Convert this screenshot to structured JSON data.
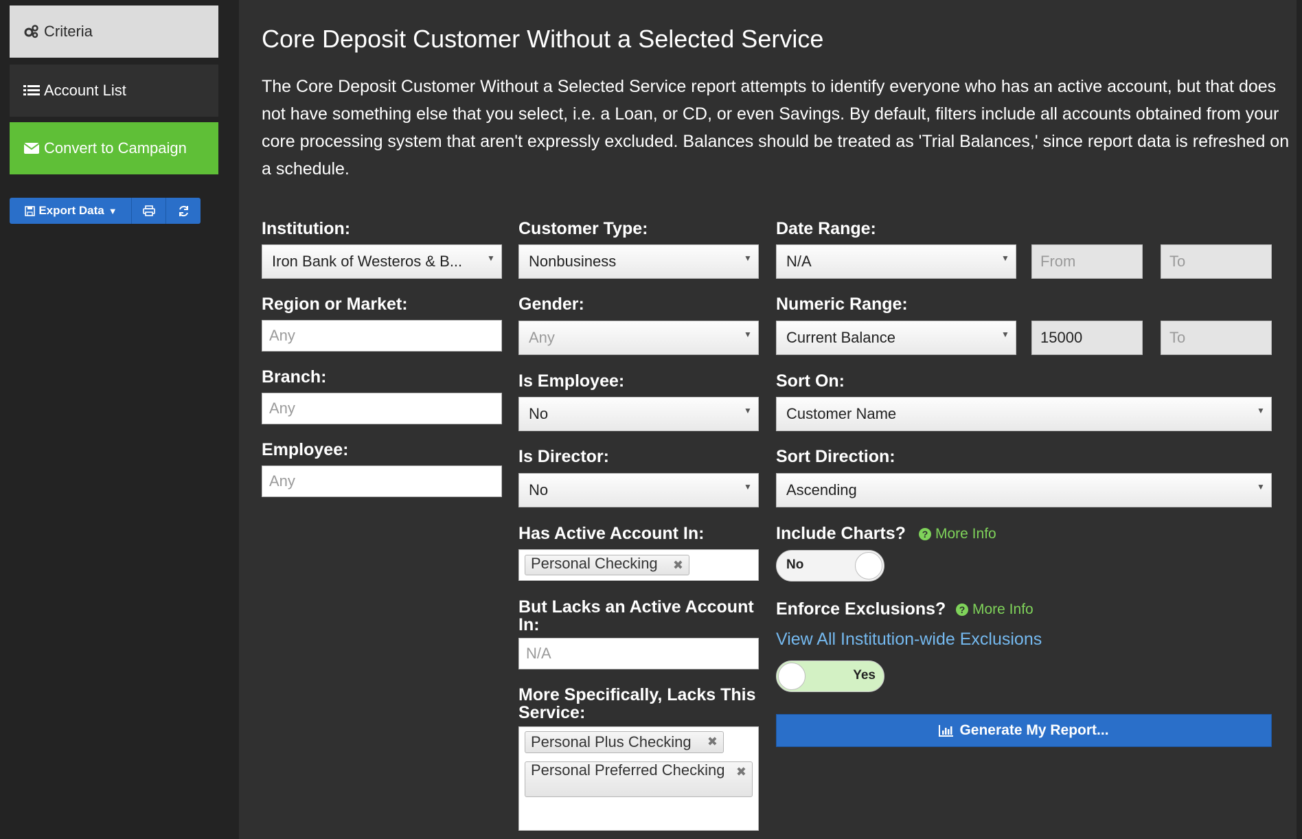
{
  "sidebar": {
    "criteria": "Criteria",
    "account_list": "Account List",
    "convert": "Convert to Campaign",
    "export": "Export Data"
  },
  "page": {
    "title": "Core Deposit Customer Without a Selected Service",
    "description": "The Core Deposit Customer Without a Selected Service report attempts to identify everyone who has an active account, but that does not have something else that you select, i.e. a Loan, or CD, or even Savings. By default, filters include all accounts obtained from your core processing system that aren't expressly excluded. Balances should be treated as 'Trial Balances,' since report data is refreshed on a schedule."
  },
  "filters": {
    "institution": {
      "label": "Institution:",
      "value": "Iron Bank of Westeros & B..."
    },
    "region": {
      "label": "Region or Market:",
      "placeholder": "Any"
    },
    "branch": {
      "label": "Branch:",
      "placeholder": "Any"
    },
    "employee": {
      "label": "Employee:",
      "placeholder": "Any"
    },
    "customer_type": {
      "label": "Customer Type:",
      "value": "Nonbusiness"
    },
    "gender": {
      "label": "Gender:",
      "value": "Any"
    },
    "is_employee": {
      "label": "Is Employee:",
      "value": "No"
    },
    "is_director": {
      "label": "Is Director:",
      "value": "No"
    },
    "has_active": {
      "label": "Has Active Account In:",
      "tags": [
        "Personal Checking"
      ]
    },
    "lacks_active": {
      "label": "But Lacks an Active Account In:",
      "placeholder": "N/A"
    },
    "lacks_service": {
      "label": "More Specifically, Lacks This Service:",
      "tags": [
        "Personal Plus Checking",
        "Personal Preferred Checking"
      ]
    },
    "date_range": {
      "label": "Date Range:",
      "value": "N/A",
      "from_placeholder": "From",
      "to_placeholder": "To"
    },
    "numeric_range": {
      "label": "Numeric Range:",
      "value": "Current Balance",
      "from_value": "15000",
      "to_placeholder": "To"
    },
    "sort_on": {
      "label": "Sort On:",
      "value": "Customer Name"
    },
    "sort_direction": {
      "label": "Sort Direction:",
      "value": "Ascending"
    },
    "include_charts": {
      "label": "Include Charts?",
      "more_info": "More Info",
      "toggle": "No"
    },
    "enforce_exclusions": {
      "label": "Enforce Exclusions?",
      "more_info": "More Info",
      "link": "View All Institution-wide Exclusions",
      "toggle": "Yes"
    }
  },
  "generate_button": "Generate My Report...",
  "colors": {
    "accent_green": "#5fbf37",
    "accent_blue": "#2a6fc9",
    "link_blue": "#75b9ef"
  }
}
